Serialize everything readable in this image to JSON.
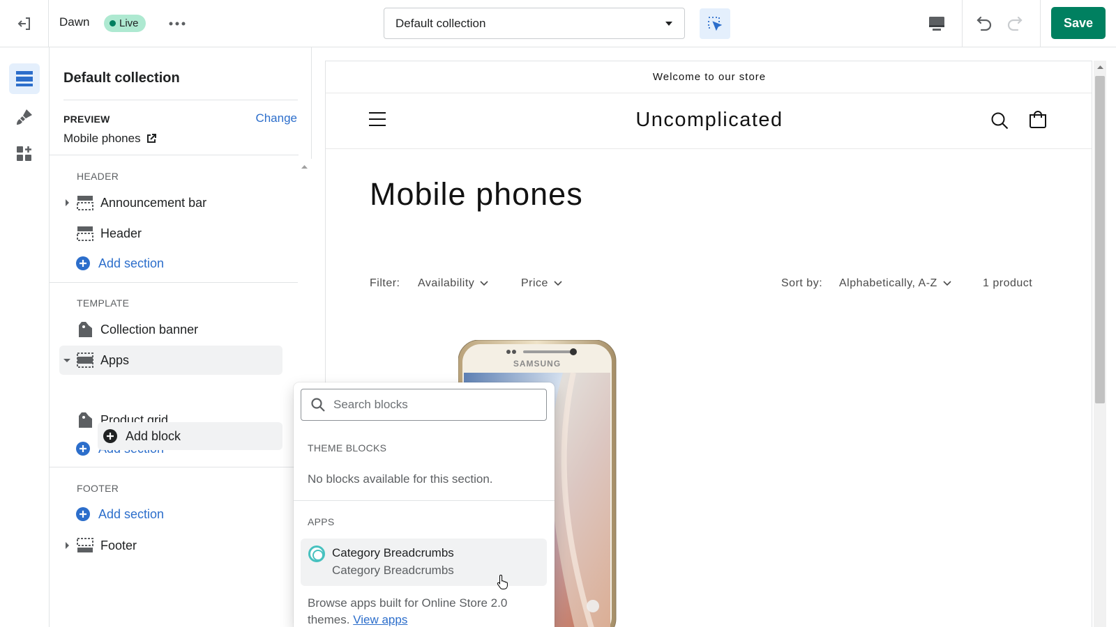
{
  "topbar": {
    "theme_name": "Dawn",
    "live_badge": "Live",
    "template_select": "Default collection",
    "save_label": "Save"
  },
  "rail": {
    "items": [
      {
        "name": "sections",
        "active": true
      },
      {
        "name": "theme-settings",
        "active": false
      },
      {
        "name": "app-embeds",
        "active": false
      }
    ]
  },
  "sidebar": {
    "title": "Default collection",
    "preview_label": "PREVIEW",
    "change_label": "Change",
    "preview_value": "Mobile phones",
    "groups": {
      "header": "HEADER",
      "template": "TEMPLATE",
      "footer": "FOOTER"
    },
    "rows": {
      "announcement_bar": "Announcement bar",
      "header": "Header",
      "collection_banner": "Collection banner",
      "apps": "Apps",
      "add_block": "Add block",
      "product_grid": "Product grid",
      "footer": "Footer"
    },
    "add_section": "Add section"
  },
  "preview": {
    "announcement": "Welcome to our store",
    "store_name": "Uncomplicated",
    "collection_title": "Mobile phones",
    "filter_label": "Filter:",
    "filter_availability": "Availability",
    "filter_price": "Price",
    "sort_label": "Sort by:",
    "sort_value": "Alphabetically, A-Z",
    "product_count": "1 product",
    "phone_brand": "SAMSUNG"
  },
  "popover": {
    "search_placeholder": "Search blocks",
    "theme_blocks_label": "THEME BLOCKS",
    "theme_blocks_empty": "No blocks available for this section.",
    "apps_label": "APPS",
    "app_name": "Category Breadcrumbs",
    "app_sub": "Category Breadcrumbs",
    "browse_text": "Browse apps built for Online Store 2.0 themes.",
    "view_apps": "View apps"
  },
  "colors": {
    "accent": "#2c6ecb",
    "save_green": "#008060",
    "live_badge": "#aee9d1",
    "selected_bg": "#e4effc"
  }
}
